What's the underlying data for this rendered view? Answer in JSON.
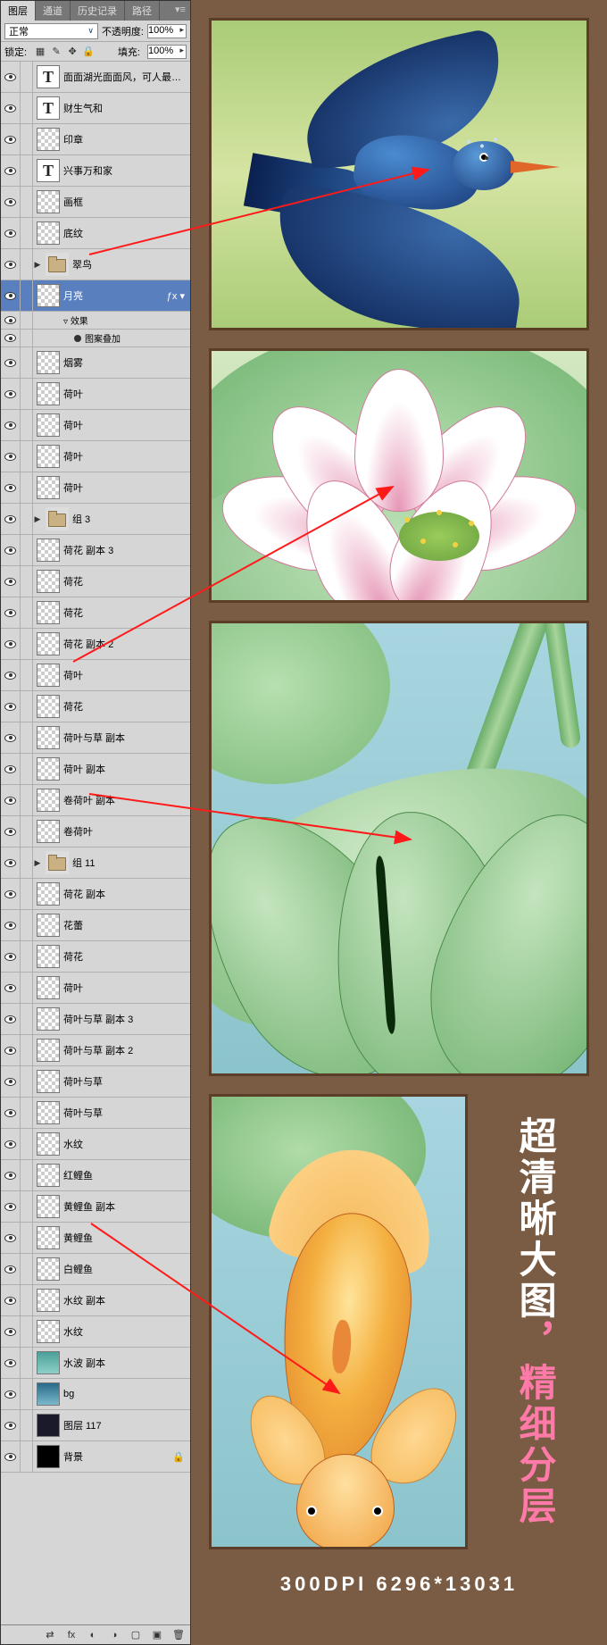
{
  "panel": {
    "tabs": [
      "图层",
      "通道",
      "历史记录",
      "路径"
    ],
    "active_tab": 0,
    "blend_mode": "正常",
    "opacity_label": "不透明度:",
    "opacity_value": "100%",
    "lock_label": "锁定:",
    "fill_label": "填充:",
    "fill_value": "100%"
  },
  "layers": [
    {
      "name": "面面湖光面面风，可人最…",
      "thumb": "T",
      "type": "text"
    },
    {
      "name": "财生气和",
      "thumb": "T",
      "type": "text"
    },
    {
      "name": "印章",
      "thumb": "trans",
      "type": "raster"
    },
    {
      "name": "兴事万和家",
      "thumb": "T",
      "type": "text"
    },
    {
      "name": "画框",
      "thumb": "trans",
      "type": "raster"
    },
    {
      "name": "底纹",
      "thumb": "trans",
      "type": "raster"
    },
    {
      "name": "翠鸟",
      "thumb": "folder",
      "type": "group",
      "toggle": "▶"
    },
    {
      "name": "月亮",
      "thumb": "trans",
      "type": "raster",
      "selected": true,
      "brush": true,
      "effects": true
    },
    {
      "name": "烟雾",
      "thumb": "trans",
      "type": "raster"
    },
    {
      "name": "荷叶",
      "thumb": "trans",
      "type": "raster"
    },
    {
      "name": "荷叶",
      "thumb": "trans",
      "type": "raster"
    },
    {
      "name": "荷叶",
      "thumb": "trans",
      "type": "raster"
    },
    {
      "name": "荷叶",
      "thumb": "trans",
      "type": "raster"
    },
    {
      "name": "组 3",
      "thumb": "folder",
      "type": "group",
      "toggle": "▶"
    },
    {
      "name": "荷花 副本 3",
      "thumb": "trans",
      "type": "raster"
    },
    {
      "name": "荷花",
      "thumb": "trans",
      "type": "raster"
    },
    {
      "name": "荷花",
      "thumb": "trans",
      "type": "raster"
    },
    {
      "name": "荷花 副本 2",
      "thumb": "trans",
      "type": "raster"
    },
    {
      "name": "荷叶",
      "thumb": "trans",
      "type": "raster"
    },
    {
      "name": "荷花",
      "thumb": "trans",
      "type": "raster"
    },
    {
      "name": "荷叶与草 副本",
      "thumb": "trans",
      "type": "raster"
    },
    {
      "name": "荷叶 副本",
      "thumb": "trans",
      "type": "raster"
    },
    {
      "name": "卷荷叶 副本",
      "thumb": "trans",
      "type": "raster"
    },
    {
      "name": "卷荷叶",
      "thumb": "trans",
      "type": "raster"
    },
    {
      "name": "组 11",
      "thumb": "folder",
      "type": "group",
      "toggle": "▶"
    },
    {
      "name": "荷花 副本",
      "thumb": "trans",
      "type": "raster"
    },
    {
      "name": "花蕾",
      "thumb": "trans",
      "type": "raster"
    },
    {
      "name": "荷花",
      "thumb": "trans",
      "type": "raster"
    },
    {
      "name": "荷叶",
      "thumb": "trans",
      "type": "raster"
    },
    {
      "name": "荷叶与草 副本 3",
      "thumb": "trans",
      "type": "raster"
    },
    {
      "name": "荷叶与草 副本 2",
      "thumb": "trans",
      "type": "raster"
    },
    {
      "name": "荷叶与草",
      "thumb": "trans",
      "type": "raster"
    },
    {
      "name": "荷叶与草",
      "thumb": "trans",
      "type": "raster"
    },
    {
      "name": "水纹",
      "thumb": "trans",
      "type": "raster"
    },
    {
      "name": "红鲤鱼",
      "thumb": "trans",
      "type": "raster"
    },
    {
      "name": "黄鲤鱼 副本",
      "thumb": "trans",
      "type": "raster"
    },
    {
      "name": "黄鲤鱼",
      "thumb": "trans",
      "type": "raster"
    },
    {
      "name": "白鲤鱼",
      "thumb": "trans",
      "type": "raster"
    },
    {
      "name": "水纹 副本",
      "thumb": "trans",
      "type": "raster"
    },
    {
      "name": "水纹",
      "thumb": "trans",
      "type": "raster"
    },
    {
      "name": "水波 副本",
      "thumb": "teal",
      "type": "raster"
    },
    {
      "name": "bg",
      "thumb": "gradient",
      "type": "raster"
    },
    {
      "name": "图层 117",
      "thumb": "dark",
      "type": "raster"
    },
    {
      "name": "背景",
      "thumb": "black",
      "type": "raster",
      "locked": true
    }
  ],
  "effects": {
    "fx_label": "效果",
    "overlay_label": "图案叠加"
  },
  "samples": [
    "翠鸟",
    "荷花",
    "卷荷叶",
    "黄鲤鱼"
  ],
  "side_text_1": "超清晰大图",
  "side_text_sep": "，",
  "side_text_2": "精细分层",
  "footer": "300DPI  6296*13031"
}
